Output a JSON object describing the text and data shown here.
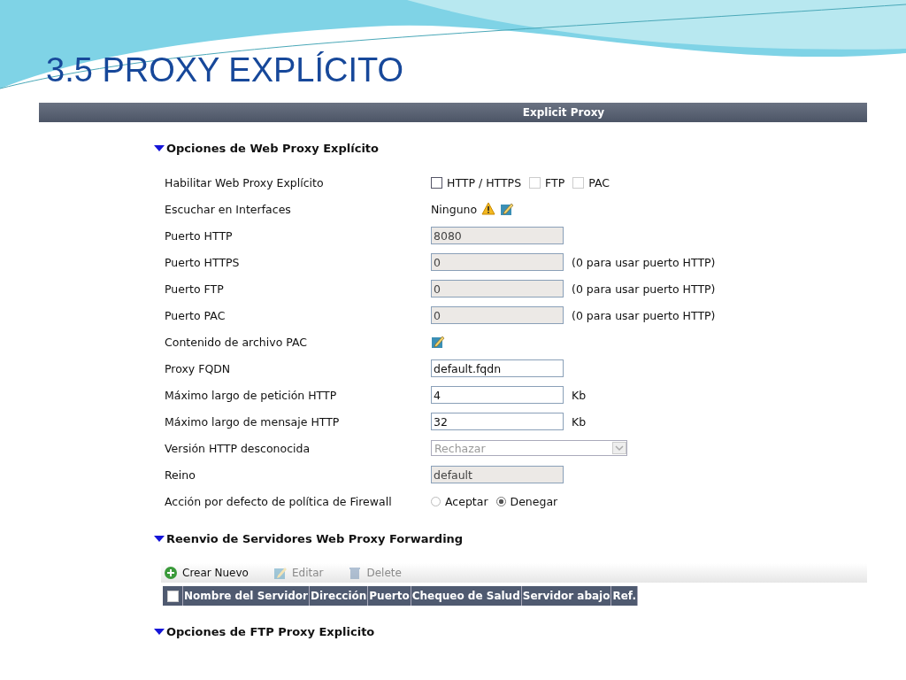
{
  "slide_title": "3.5 PROXY EXPLÍCITO",
  "panel": {
    "title": "Explicit Proxy",
    "sections": [
      {
        "title": "Opciones de Web Proxy Explícito",
        "expanded": true,
        "rows": [
          {
            "kind": "checks",
            "label": "Habilitar Web Proxy Explícito",
            "options": [
              {
                "label": "HTTP / HTTPS",
                "checked": false,
                "disabled": false
              },
              {
                "label": "FTP",
                "checked": false,
                "disabled": true
              },
              {
                "label": "PAC",
                "checked": false,
                "disabled": true
              }
            ]
          },
          {
            "kind": "interfaces",
            "label": "Escuchar en Interfaces",
            "value": "Ninguno"
          },
          {
            "kind": "input",
            "label": "Puerto HTTP",
            "value": "8080",
            "disabled": true
          },
          {
            "kind": "input",
            "label": "Puerto HTTPS",
            "value": "0",
            "disabled": true,
            "hint": "(0 para usar puerto HTTP)"
          },
          {
            "kind": "input",
            "label": "Puerto FTP",
            "value": "0",
            "disabled": true,
            "hint": "(0 para usar puerto HTTP)"
          },
          {
            "kind": "input",
            "label": "Puerto PAC",
            "value": "0",
            "disabled": true,
            "hint": "(0 para usar puerto HTTP)"
          },
          {
            "kind": "edit",
            "label": "Contenido de archivo PAC"
          },
          {
            "kind": "input",
            "label": "Proxy FQDN",
            "value": "default.fqdn",
            "disabled": false
          },
          {
            "kind": "input",
            "label": "Máximo largo de petición HTTP",
            "value": "4",
            "disabled": false,
            "hint": "Kb"
          },
          {
            "kind": "input",
            "label": "Máximo largo de mensaje HTTP",
            "value": "32",
            "disabled": false,
            "hint": "Kb"
          },
          {
            "kind": "select",
            "label": "Versión HTTP desconocida",
            "value": "Rechazar",
            "disabled": true
          },
          {
            "kind": "input",
            "label": "Reino",
            "value": "default",
            "disabled": true
          },
          {
            "kind": "radios",
            "label": "Acción por defecto de política de Firewall",
            "options": [
              {
                "label": "Aceptar",
                "selected": false
              },
              {
                "label": "Denegar",
                "selected": true
              }
            ]
          }
        ]
      },
      {
        "title": "Reenvio de Servidores Web Proxy Forwarding",
        "expanded": true,
        "toolbar": [
          {
            "kind": "add",
            "label": "Crear Nuevo",
            "disabled": false
          },
          {
            "kind": "edit",
            "label": "Editar",
            "disabled": true
          },
          {
            "kind": "delete",
            "label": "Delete",
            "disabled": true
          }
        ],
        "table": {
          "select_all": false,
          "columns": [
            "Nombre del Servidor",
            "Dirección",
            "Puerto",
            "Chequeo de Salud",
            "Servidor abajo",
            "Ref."
          ]
        }
      },
      {
        "title": "Opciones de FTP Proxy Explicito",
        "expanded": true
      }
    ]
  }
}
